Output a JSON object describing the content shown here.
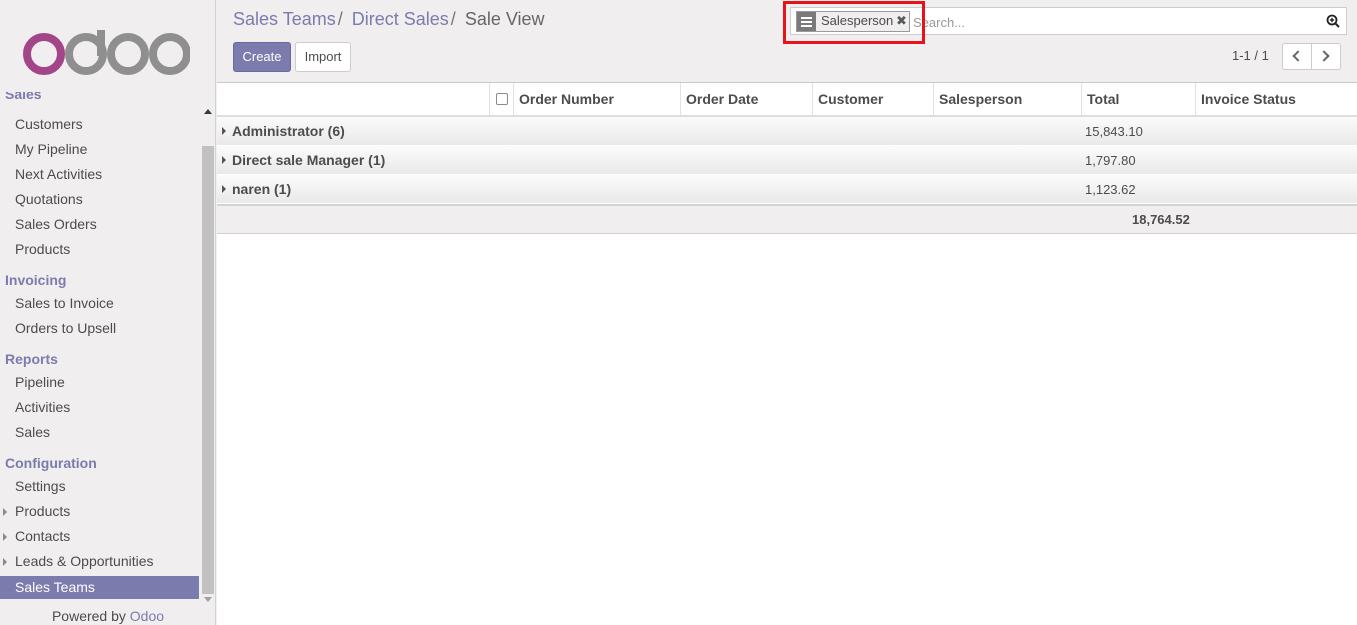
{
  "brand": {
    "logo_text": "odoo",
    "accent": "#7c7bad",
    "highlight": "#e8121b"
  },
  "sidebar": {
    "cut_heading": "Sales",
    "sales_items": [
      "Customers",
      "My Pipeline",
      "Next Activities",
      "Quotations",
      "Sales Orders",
      "Products"
    ],
    "invoicing": {
      "heading": "Invoicing",
      "items": [
        "Sales to Invoice",
        "Orders to Upsell"
      ]
    },
    "reports": {
      "heading": "Reports",
      "items": [
        "Pipeline",
        "Activities",
        "Sales"
      ]
    },
    "configuration": {
      "heading": "Configuration",
      "items": [
        {
          "label": "Settings",
          "expandable": false
        },
        {
          "label": "Products",
          "expandable": true
        },
        {
          "label": "Contacts",
          "expandable": true
        },
        {
          "label": "Leads & Opportunities",
          "expandable": true
        },
        {
          "label": "Sales Teams",
          "expandable": false,
          "active": true
        }
      ]
    },
    "powered_by": "Powered by",
    "powered_brand": "Odoo"
  },
  "breadcrumb": {
    "items": [
      "Sales Teams",
      "Direct Sales"
    ],
    "current": "Sale View",
    "separator": "/"
  },
  "buttons": {
    "create": "Create",
    "import": "Import"
  },
  "search": {
    "facet_label": "Salesperson",
    "facet_icon": "group-by-icon",
    "remove_symbol": "✖",
    "placeholder": "Search..."
  },
  "pager": {
    "value": "1-1 / 1"
  },
  "table": {
    "columns": [
      "Order Number",
      "Order Date",
      "Customer",
      "Salesperson",
      "Total",
      "Invoice Status"
    ],
    "groups": [
      {
        "name": "Administrator (6)",
        "total": "15,843.10"
      },
      {
        "name": "Direct sale Manager (1)",
        "total": "1,797.80"
      },
      {
        "name": "naren (1)",
        "total": "1,123.62"
      }
    ],
    "grand_total": "18,764.52"
  }
}
